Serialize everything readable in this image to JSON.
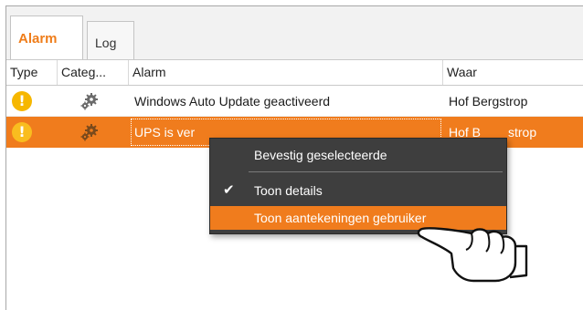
{
  "tabs": [
    {
      "label": "Alarm",
      "active": true
    },
    {
      "label": "Log",
      "active": false
    }
  ],
  "columns": [
    "Type",
    "Categ...",
    "Alarm",
    "Waar"
  ],
  "rows": [
    {
      "alarm": "Windows Auto Update geactiveerd",
      "waar": "Hof Bergstrop",
      "selected": false
    },
    {
      "alarm": "UPS is ver",
      "waar": "Hof B",
      "waar_tail": "strop",
      "selected": true
    }
  ],
  "icons": {
    "type": "warning-icon",
    "category": "gears-icon",
    "cursor": "pointing-hand-icon",
    "check": "checkmark-icon"
  },
  "context_menu": {
    "items": [
      {
        "label": "Bevestig geselecteerde",
        "checked": false,
        "highlighted": false
      },
      {
        "label": "Toon details",
        "checked": true,
        "highlighted": false
      },
      {
        "label": "Toon aantekeningen gebruiker",
        "checked": false,
        "highlighted": true
      }
    ],
    "check_glyph": "✔"
  },
  "warn_glyph": "!",
  "colors": {
    "accent": "#f07c1d",
    "warning": "#f6b700",
    "menu_bg": "#3e3e3e"
  }
}
